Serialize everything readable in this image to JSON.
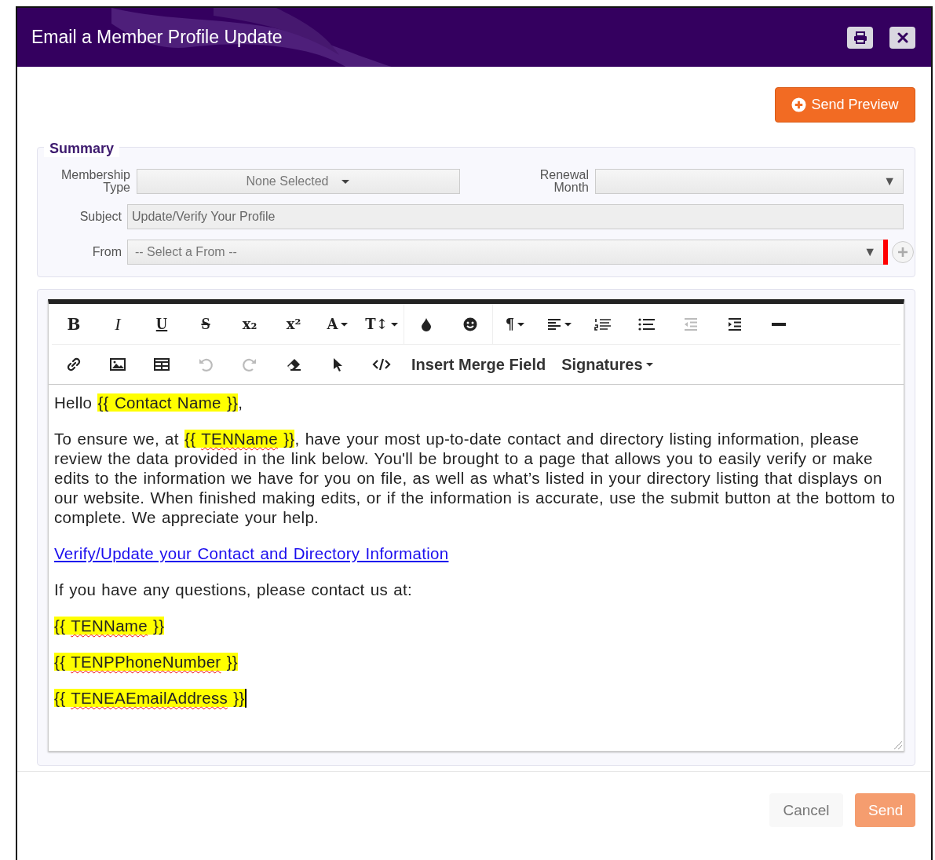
{
  "dialog": {
    "title": "Email a Member Profile Update"
  },
  "header_buttons": [
    {
      "kind": "print"
    },
    {
      "kind": "close"
    }
  ],
  "send_preview": {
    "label": "Send Preview"
  },
  "summary": {
    "legend": "Summary",
    "membership_type": {
      "label": [
        "Membership",
        "Type"
      ],
      "value": "None Selected"
    },
    "renewal_month": {
      "label": [
        "Renewal",
        "Month"
      ],
      "arrow": "▼"
    },
    "subject": {
      "label": "Subject",
      "value": "Update/Verify Your Profile"
    },
    "from": {
      "label": "From",
      "value": "-- Select a From --",
      "arrow": "▼",
      "required": true
    }
  },
  "toolbar": {
    "rows": [
      {
        "groups": [
          {
            "tools": [
              {
                "kind": "bold",
                "label": "B",
                "dropdown": false,
                "disabled": false
              },
              {
                "kind": "italic",
                "label": "I",
                "dropdown": false,
                "disabled": false
              },
              {
                "kind": "underline",
                "label": "U",
                "dropdown": false,
                "disabled": false
              },
              {
                "kind": "strike",
                "label": "S",
                "dropdown": false,
                "disabled": false
              },
              {
                "kind": "glyph",
                "label": "x₂",
                "dropdown": false,
                "disabled": false
              },
              {
                "kind": "glyph",
                "label": "x²",
                "dropdown": false,
                "disabled": false
              },
              {
                "kind": "glyph",
                "label": "A",
                "dropdown": true,
                "disabled": false
              },
              {
                "kind": "glyph",
                "label": "T↕",
                "dropdown": true,
                "disabled": false
              }
            ]
          },
          {
            "tools": [
              {
                "kind": "drop",
                "dropdown": false,
                "disabled": false
              },
              {
                "kind": "smile",
                "dropdown": false,
                "disabled": false
              }
            ]
          },
          {
            "tools": [
              {
                "kind": "glyph",
                "label": "¶",
                "dropdown": true,
                "disabled": false
              },
              {
                "kind": "align",
                "dropdown": true,
                "disabled": false
              },
              {
                "kind": "ordered",
                "dropdown": false,
                "disabled": false
              },
              {
                "kind": "bullets",
                "dropdown": false,
                "disabled": false
              },
              {
                "kind": "outdent",
                "dropdown": false,
                "disabled": true
              },
              {
                "kind": "indent",
                "dropdown": false,
                "disabled": false
              },
              {
                "kind": "rule",
                "dropdown": false,
                "disabled": false
              }
            ]
          }
        ]
      },
      {
        "groups": [
          {
            "tools": [
              {
                "kind": "link",
                "dropdown": false,
                "disabled": false
              },
              {
                "kind": "image",
                "dropdown": false,
                "disabled": false
              },
              {
                "kind": "table",
                "dropdown": false,
                "disabled": false
              },
              {
                "kind": "undo",
                "dropdown": false,
                "disabled": true
              },
              {
                "kind": "redo",
                "dropdown": false,
                "disabled": true
              },
              {
                "kind": "eraser",
                "dropdown": false,
                "disabled": false
              },
              {
                "kind": "pointer",
                "dropdown": false,
                "disabled": false
              },
              {
                "kind": "code",
                "dropdown": false,
                "disabled": false
              },
              {
                "kind": "text",
                "label": "Insert Merge Field",
                "dropdown": false,
                "disabled": false
              },
              {
                "kind": "text",
                "label": "Signatures",
                "dropdown": true,
                "disabled": false
              }
            ]
          }
        ]
      }
    ]
  },
  "body": [
    [
      {
        "kind": "plain",
        "text": "Hello "
      },
      {
        "kind": "merge",
        "open": "{{ ",
        "name": "Contact Name",
        "close": " }}",
        "misspelled": false
      },
      {
        "kind": "plain",
        "text": ","
      }
    ],
    [
      {
        "kind": "plain",
        "text": "To ensure we, at "
      },
      {
        "kind": "merge",
        "open": "{{ ",
        "name": "TENName",
        "close": " }}",
        "misspelled": true
      },
      {
        "kind": "plain",
        "text": ", have your most up-to-date contact and directory listing information, please review the data provided in the link below. You'll be brought to a page that allows you to easily verify or make edits to the information we have for you on file, as well as what’s listed in your directory listing that displays on our website. When finished making edits, or if the information is accurate, use the submit button at the bottom to complete. We appreciate your help."
      }
    ],
    [
      {
        "kind": "link",
        "text": "Verify/Update your Contact and Directory Information"
      }
    ],
    [
      {
        "kind": "plain",
        "text": "If you have any questions, please contact us at:"
      }
    ],
    [
      {
        "kind": "merge",
        "open": "{{ ",
        "name": "TENName",
        "close": " }}",
        "misspelled": true
      }
    ],
    [
      {
        "kind": "merge",
        "open": "{{ ",
        "name": "TENPPhoneNumber",
        "close": " }}",
        "misspelled": true
      }
    ],
    [
      {
        "kind": "merge",
        "open": "{{ ",
        "name": "TENEAEmailAddress",
        "close": " }}",
        "misspelled": true
      },
      {
        "kind": "caret"
      }
    ]
  ],
  "footer": {
    "buttons": [
      {
        "label": "Cancel",
        "kind": "cancel",
        "disabled": false
      },
      {
        "label": "Send",
        "kind": "primary",
        "disabled": true
      }
    ]
  }
}
